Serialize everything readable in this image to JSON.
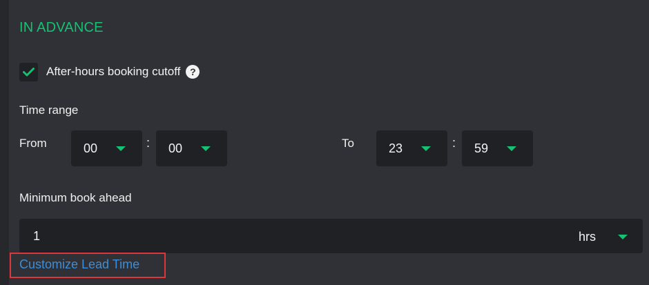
{
  "section": {
    "title": "IN ADVANCE",
    "accent_color": "#16c172"
  },
  "after_hours": {
    "checked": true,
    "label": "After-hours booking cutoff",
    "help_icon": "question-circle-icon",
    "help_glyph": "?"
  },
  "time_range": {
    "label": "Time range",
    "from_label": "From",
    "to_label": "To",
    "separator": ":",
    "from_hour": "00",
    "from_minute": "00",
    "to_hour": "23",
    "to_minute": "59"
  },
  "min_book_ahead": {
    "label": "Minimum book ahead",
    "value": "1",
    "unit": "hrs"
  },
  "customize_link": {
    "label": "Customize Lead Time",
    "color": "#3d8ed6",
    "highlight_color": "#e0363b"
  }
}
